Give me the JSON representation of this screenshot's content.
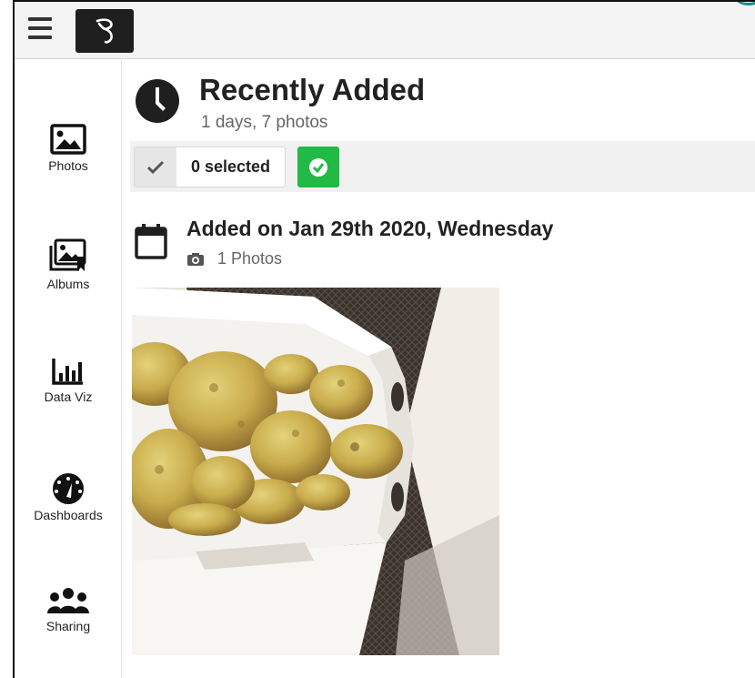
{
  "nav": {
    "items": [
      {
        "label": "Photos",
        "icon": "image-icon"
      },
      {
        "label": "Albums",
        "icon": "albums-icon"
      },
      {
        "label": "Data Viz",
        "icon": "bar-chart-icon"
      },
      {
        "label": "Dashboards",
        "icon": "gauge-icon"
      },
      {
        "label": "Sharing",
        "icon": "users-icon"
      }
    ]
  },
  "header": {
    "title": "Recently Added",
    "subtitle": "1 days, 7 photos",
    "icon": "clock-icon"
  },
  "selection": {
    "count_label": "0 selected"
  },
  "group": {
    "title": "Added on Jan 29th 2020, Wednesday",
    "count_label": "1 Photos"
  },
  "colors": {
    "topbar_bg": "#f3f3f3",
    "accent_green": "#21ba45",
    "logo_bg": "#1f1f1f",
    "muted_text": "#666666"
  }
}
